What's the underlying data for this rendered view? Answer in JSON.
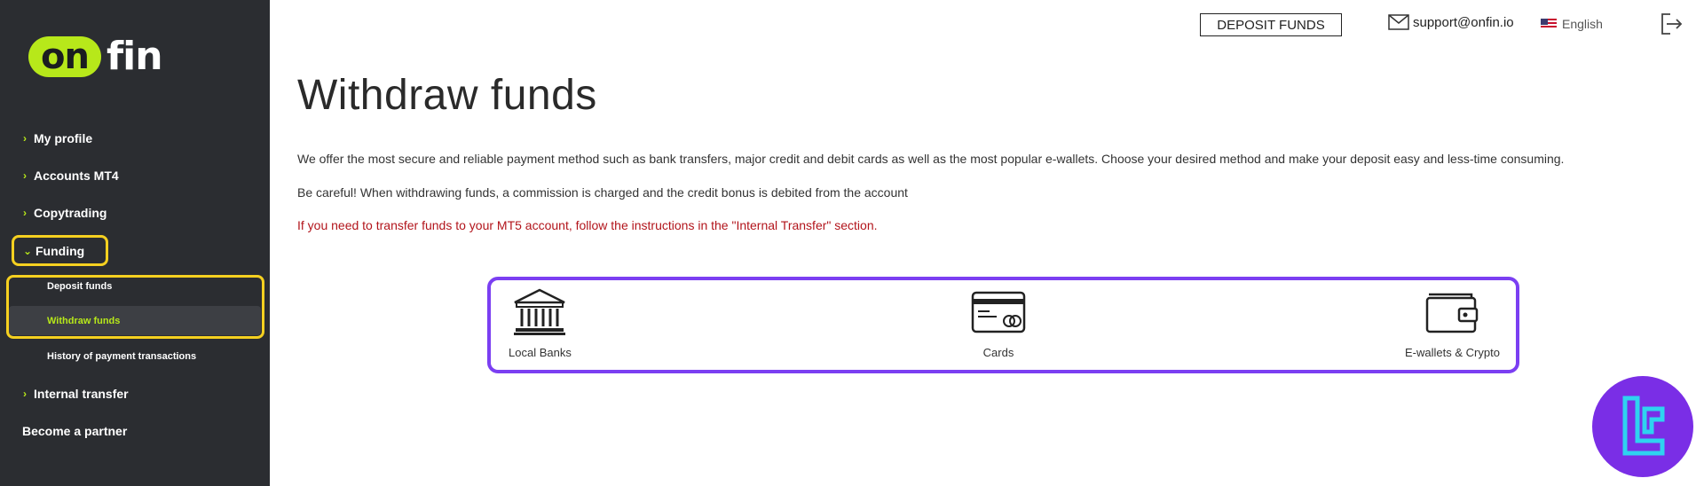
{
  "brand": {
    "logo_on": "on",
    "logo_fin": "fin",
    "accent_color": "#b7e81a",
    "sidebar_bg": "#2b2d31"
  },
  "sidebar": {
    "items": [
      {
        "label": "My profile"
      },
      {
        "label": "Accounts MT4"
      },
      {
        "label": "Copytrading"
      },
      {
        "label": "Funding",
        "expanded": true
      },
      {
        "label": "Internal transfer"
      },
      {
        "label": "Become a partner"
      }
    ],
    "funding_sub": [
      {
        "label": "Deposit funds"
      },
      {
        "label": "Withdraw funds",
        "active": true
      },
      {
        "label": "History of payment transactions"
      }
    ]
  },
  "header": {
    "deposit_button": "DEPOSIT FUNDS",
    "support_email": "support@onfin.io",
    "language": "English"
  },
  "main": {
    "title": "Withdraw funds",
    "intro": "We offer the most secure and reliable payment method such as bank transfers, major credit and debit cards as well as the most popular e-wallets. Choose your desired method and make your deposit easy and less-time consuming.",
    "warning": "Be careful! When withdrawing funds, a commission is charged and the credit bonus is debited from the account",
    "notice": "If you need to transfer funds to your MT5 account, follow the instructions in the \"Internal Transfer\" section.",
    "notice_color": "#b2141b",
    "methods": [
      {
        "label": "Local Banks",
        "icon": "bank-icon"
      },
      {
        "label": "Cards",
        "icon": "credit-card-icon"
      },
      {
        "label": "E-wallets & Crypto",
        "icon": "wallet-icon"
      }
    ]
  },
  "annotations": {
    "highlight_color": "#f5d020",
    "methods_border_color": "#7b3ff2"
  }
}
